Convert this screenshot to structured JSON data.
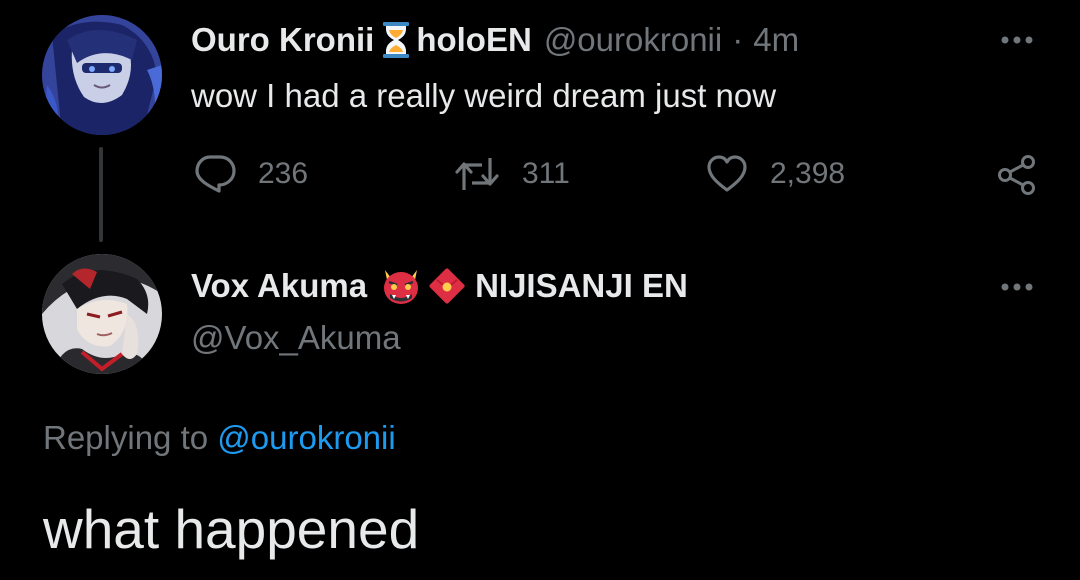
{
  "original_tweet": {
    "display_name": "Ouro Kronii",
    "name_emoji": "hourglass-icon",
    "affiliation": "holoEN",
    "handle": "@ourokronii",
    "separator": "·",
    "time": "4m",
    "text": "wow I had a really weird dream just now",
    "actions": {
      "replies": "236",
      "retweets": "311",
      "likes": "2,398"
    }
  },
  "reply_tweet": {
    "display_name": "Vox Akuma",
    "name_emojis": [
      "oni-mask-icon",
      "red-envelope-icon"
    ],
    "affiliation": "NIJISANJI EN",
    "handle": "@Vox_Akuma",
    "replying_prefix": "Replying to",
    "replying_mention": "@ourokronii",
    "text": "what happened"
  },
  "colors": {
    "background": "#000000",
    "primary_text": "#e7e9ea",
    "secondary_text": "#71767b",
    "link": "#1d9bf0",
    "thread_line": "#333639"
  }
}
